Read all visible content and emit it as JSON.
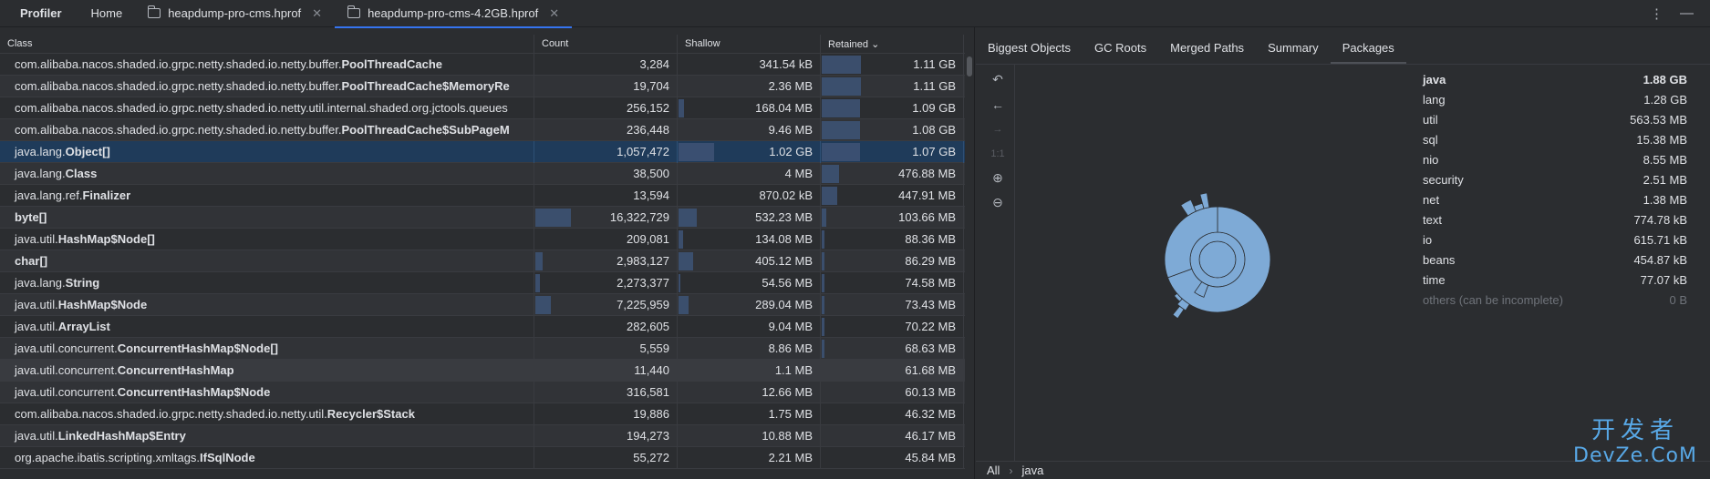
{
  "topbar": {
    "app_title": "Profiler",
    "tabs": [
      {
        "label": "Home",
        "icon": ""
      },
      {
        "label": "heapdump-pro-cms.hprof",
        "icon": "folder-icon",
        "closable": true
      },
      {
        "label": "heapdump-pro-cms-4.2GB.hprof",
        "icon": "folder-icon",
        "closable": true,
        "active": true
      }
    ],
    "close_glyph": "✕",
    "more_glyph": "⋮",
    "minimize_glyph": "—"
  },
  "table": {
    "columns": {
      "class": "Class",
      "count": "Count",
      "shallow": "Shallow",
      "retained": "Retained"
    },
    "sort_glyph": "⌄",
    "rows": [
      {
        "pkg": "com.alibaba.nacos.shaded.io.grpc.netty.shaded.io.netty.buffer.",
        "cls": "PoolThreadCache",
        "count": "3,284",
        "shallow": "341.54 kB",
        "retained": "1.11 GB",
        "count_frac": 0.0,
        "shallow_frac": 0.0,
        "retained_frac": 0.28
      },
      {
        "pkg": "com.alibaba.nacos.shaded.io.grpc.netty.shaded.io.netty.buffer.",
        "cls": "PoolThreadCache$MemoryRe",
        "count": "19,704",
        "shallow": "2.36 MB",
        "retained": "1.11 GB",
        "count_frac": 0.0,
        "shallow_frac": 0.0,
        "retained_frac": 0.28
      },
      {
        "pkg": "com.alibaba.nacos.shaded.io.grpc.netty.shaded.io.netty.util.internal.shaded.org.jctools.queues",
        "cls": "",
        "count": "256,152",
        "shallow": "168.04 MB",
        "retained": "1.09 GB",
        "count_frac": 0.0,
        "shallow_frac": 0.04,
        "retained_frac": 0.27
      },
      {
        "pkg": "com.alibaba.nacos.shaded.io.grpc.netty.shaded.io.netty.buffer.",
        "cls": "PoolThreadCache$SubPageM",
        "count": "236,448",
        "shallow": "9.46 MB",
        "retained": "1.08 GB",
        "count_frac": 0.0,
        "shallow_frac": 0.0,
        "retained_frac": 0.27
      },
      {
        "pkg": "java.lang.",
        "cls": "Object[]",
        "count": "1,057,472",
        "shallow": "1.02 GB",
        "retained": "1.07 GB",
        "count_frac": 0.0,
        "shallow_frac": 0.25,
        "retained_frac": 0.27,
        "selected": true
      },
      {
        "pkg": "java.lang.",
        "cls": "Class",
        "count": "38,500",
        "shallow": "4 MB",
        "retained": "476.88 MB",
        "count_frac": 0.0,
        "shallow_frac": 0.0,
        "retained_frac": 0.12
      },
      {
        "pkg": "java.lang.ref.",
        "cls": "Finalizer",
        "count": "13,594",
        "shallow": "870.02 kB",
        "retained": "447.91 MB",
        "count_frac": 0.0,
        "shallow_frac": 0.0,
        "retained_frac": 0.11
      },
      {
        "pkg": "",
        "cls": "byte[]",
        "count": "16,322,729",
        "shallow": "532.23 MB",
        "retained": "103.66 MB",
        "count_frac": 0.25,
        "shallow_frac": 0.13,
        "retained_frac": 0.03
      },
      {
        "pkg": "java.util.",
        "cls": "HashMap$Node[]",
        "count": "209,081",
        "shallow": "134.08 MB",
        "retained": "88.36 MB",
        "count_frac": 0.0,
        "shallow_frac": 0.03,
        "retained_frac": 0.02
      },
      {
        "pkg": "",
        "cls": "char[]",
        "count": "2,983,127",
        "shallow": "405.12 MB",
        "retained": "86.29 MB",
        "count_frac": 0.05,
        "shallow_frac": 0.1,
        "retained_frac": 0.02
      },
      {
        "pkg": "java.lang.",
        "cls": "String",
        "count": "2,273,377",
        "shallow": "54.56 MB",
        "retained": "74.58 MB",
        "count_frac": 0.03,
        "shallow_frac": 0.01,
        "retained_frac": 0.02
      },
      {
        "pkg": "java.util.",
        "cls": "HashMap$Node",
        "count": "7,225,959",
        "shallow": "289.04 MB",
        "retained": "73.43 MB",
        "count_frac": 0.11,
        "shallow_frac": 0.07,
        "retained_frac": 0.02
      },
      {
        "pkg": "java.util.",
        "cls": "ArrayList",
        "count": "282,605",
        "shallow": "9.04 MB",
        "retained": "70.22 MB",
        "count_frac": 0.0,
        "shallow_frac": 0.0,
        "retained_frac": 0.02
      },
      {
        "pkg": "java.util.concurrent.",
        "cls": "ConcurrentHashMap$Node[]",
        "count": "5,559",
        "shallow": "8.86 MB",
        "retained": "68.63 MB",
        "count_frac": 0.0,
        "shallow_frac": 0.0,
        "retained_frac": 0.02
      },
      {
        "pkg": "java.util.concurrent.",
        "cls": "ConcurrentHashMap",
        "count": "11,440",
        "shallow": "1.1 MB",
        "retained": "61.68 MB",
        "count_frac": 0.0,
        "shallow_frac": 0.0,
        "retained_frac": 0.0,
        "hover": true
      },
      {
        "pkg": "java.util.concurrent.",
        "cls": "ConcurrentHashMap$Node",
        "count": "316,581",
        "shallow": "12.66 MB",
        "retained": "60.13 MB",
        "count_frac": 0.0,
        "shallow_frac": 0.0,
        "retained_frac": 0.0
      },
      {
        "pkg": "com.alibaba.nacos.shaded.io.grpc.netty.shaded.io.netty.util.",
        "cls": "Recycler$Stack",
        "count": "19,886",
        "shallow": "1.75 MB",
        "retained": "46.32 MB",
        "count_frac": 0.0,
        "shallow_frac": 0.0,
        "retained_frac": 0.0
      },
      {
        "pkg": "java.util.",
        "cls": "LinkedHashMap$Entry",
        "count": "194,273",
        "shallow": "10.88 MB",
        "retained": "46.17 MB",
        "count_frac": 0.0,
        "shallow_frac": 0.0,
        "retained_frac": 0.0
      },
      {
        "pkg": "org.apache.ibatis.scripting.xmltags.",
        "cls": "IfSqlNode",
        "count": "55,272",
        "shallow": "2.21 MB",
        "retained": "45.84 MB",
        "count_frac": 0.0,
        "shallow_frac": 0.0,
        "retained_frac": 0.0
      }
    ]
  },
  "right": {
    "subtabs": [
      "Biggest Objects",
      "GC Roots",
      "Merged Paths",
      "Summary",
      "Packages"
    ],
    "active_subtab": "Packages",
    "tools": [
      {
        "name": "undo-icon",
        "glyph": "↶",
        "enabled": true
      },
      {
        "name": "back-icon",
        "glyph": "←",
        "enabled": true
      },
      {
        "name": "forward-icon",
        "glyph": "→",
        "enabled": false
      },
      {
        "name": "actual-size-icon",
        "glyph": "1:1",
        "enabled": false
      },
      {
        "name": "zoom-in-icon",
        "glyph": "⊕",
        "enabled": true
      },
      {
        "name": "zoom-out-icon",
        "glyph": "⊖",
        "enabled": true
      }
    ],
    "packages": [
      {
        "name": "java",
        "size": "1.88 GB",
        "head": true
      },
      {
        "name": "lang",
        "size": "1.28 GB"
      },
      {
        "name": "util",
        "size": "563.53 MB"
      },
      {
        "name": "sql",
        "size": "15.38 MB"
      },
      {
        "name": "nio",
        "size": "8.55 MB"
      },
      {
        "name": "security",
        "size": "2.51 MB"
      },
      {
        "name": "net",
        "size": "1.38 MB"
      },
      {
        "name": "text",
        "size": "774.78 kB"
      },
      {
        "name": "io",
        "size": "615.71 kB"
      },
      {
        "name": "beans",
        "size": "454.87 kB"
      },
      {
        "name": "time",
        "size": "77.07 kB"
      },
      {
        "name": "others (can be incomplete)",
        "size": "0 B",
        "muted": true
      }
    ],
    "sunburst_color": "#7eaad6",
    "breadcrumbs": [
      "All",
      "java"
    ],
    "breadcrumb_sep": "›"
  },
  "watermark": {
    "line1": "开发者",
    "line2": "DevZe.CoM"
  }
}
